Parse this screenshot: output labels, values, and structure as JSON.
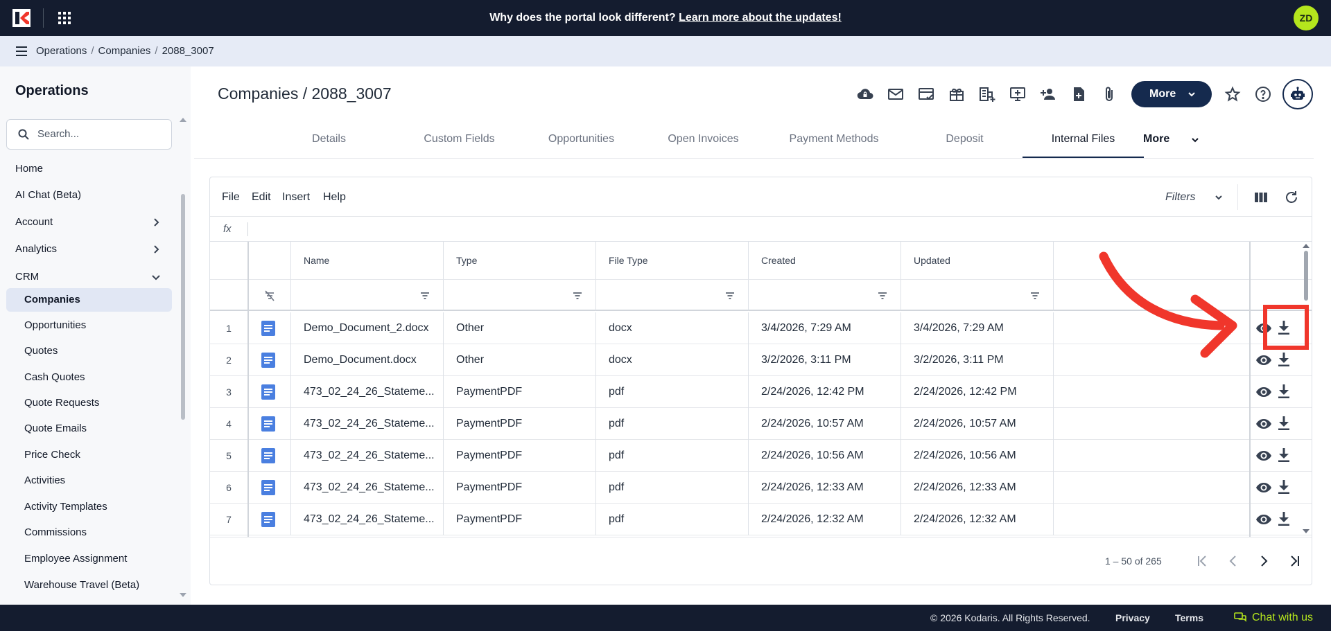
{
  "topbar": {
    "announcement_text": "Why does the portal look different?",
    "announcement_link": "Learn more about the updates!",
    "avatar_initials": "ZD"
  },
  "breadcrumb": [
    "Operations",
    "Companies",
    "2088_3007"
  ],
  "sidebar": {
    "title": "Operations",
    "search_placeholder": "Search...",
    "items": [
      {
        "label": "Home"
      },
      {
        "label": "AI Chat (Beta)"
      },
      {
        "label": "Account",
        "chevron": "chevron-right"
      },
      {
        "label": "Analytics",
        "chevron": "chevron-right"
      },
      {
        "label": "CRM",
        "chevron": "chevron-down"
      },
      {
        "label": "Companies",
        "active": true
      },
      {
        "label": "Opportunities"
      },
      {
        "label": "Quotes"
      },
      {
        "label": "Cash Quotes"
      },
      {
        "label": "Quote Requests"
      },
      {
        "label": "Quote Emails"
      },
      {
        "label": "Price Check"
      },
      {
        "label": "Activities"
      },
      {
        "label": "Activity Templates"
      },
      {
        "label": "Commissions"
      },
      {
        "label": "Employee Assignment"
      },
      {
        "label": "Warehouse Travel (Beta)"
      }
    ]
  },
  "page": {
    "title": "Companies / 2088_3007",
    "more_button": "More",
    "toolbar_icons": [
      "cloud-lock-icon",
      "mail-icon",
      "card-check-icon",
      "gift-icon",
      "building-add-icon",
      "screen-add-icon",
      "person-add-icon",
      "file-add-icon",
      "paperclip-icon"
    ]
  },
  "tabs": [
    {
      "label": "Details"
    },
    {
      "label": "Custom Fields"
    },
    {
      "label": "Opportunities"
    },
    {
      "label": "Open Invoices"
    },
    {
      "label": "Payment Methods"
    },
    {
      "label": "Deposit"
    },
    {
      "label": "Internal Files",
      "active": true
    },
    {
      "label": "More"
    }
  ],
  "grid": {
    "menu": [
      "File",
      "Edit",
      "Insert",
      "Help"
    ],
    "filters_label": "Filters",
    "fx_label": "fx",
    "columns": [
      "Name",
      "Type",
      "File Type",
      "Created",
      "Updated"
    ],
    "rows": [
      {
        "num": "1",
        "name": "Demo_Document_2.docx",
        "type": "Other",
        "file_type": "docx",
        "created": "3/4/2026, 7:29 AM",
        "updated": "3/4/2026, 7:29 AM"
      },
      {
        "num": "2",
        "name": "Demo_Document.docx",
        "type": "Other",
        "file_type": "docx",
        "created": "3/2/2026, 3:11 PM",
        "updated": "3/2/2026, 3:11 PM"
      },
      {
        "num": "3",
        "name": "473_02_24_26_Stateme...",
        "type": "PaymentPDF",
        "file_type": "pdf",
        "created": "2/24/2026, 12:42 PM",
        "updated": "2/24/2026, 12:42 PM"
      },
      {
        "num": "4",
        "name": "473_02_24_26_Stateme...",
        "type": "PaymentPDF",
        "file_type": "pdf",
        "created": "2/24/2026, 10:57 AM",
        "updated": "2/24/2026, 10:57 AM"
      },
      {
        "num": "5",
        "name": "473_02_24_26_Stateme...",
        "type": "PaymentPDF",
        "file_type": "pdf",
        "created": "2/24/2026, 10:56 AM",
        "updated": "2/24/2026, 10:56 AM"
      },
      {
        "num": "6",
        "name": "473_02_24_26_Stateme...",
        "type": "PaymentPDF",
        "file_type": "pdf",
        "created": "2/24/2026, 12:33 AM",
        "updated": "2/24/2026, 12:33 AM"
      },
      {
        "num": "7",
        "name": "473_02_24_26_Stateme...",
        "type": "PaymentPDF",
        "file_type": "pdf",
        "created": "2/24/2026, 12:32 AM",
        "updated": "2/24/2026, 12:32 AM"
      }
    ],
    "pagination": "1 – 50 of 265"
  },
  "footer": {
    "copyright": "© 2026 Kodaris. All Rights Reserved.",
    "privacy": "Privacy",
    "terms": "Terms",
    "chat": "Chat with us"
  },
  "colors": {
    "topbar": "#141c2f",
    "primary": "#152a4e",
    "accent_green": "#b5e61d",
    "doc_icon": "#4a7fe0",
    "annotation": "#f0362b"
  }
}
